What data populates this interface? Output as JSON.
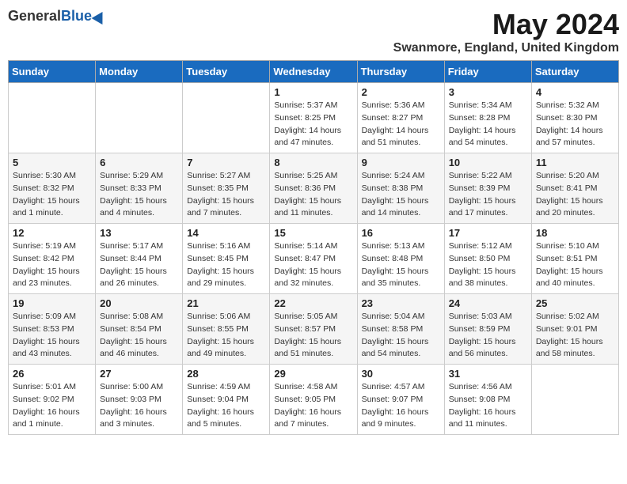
{
  "header": {
    "logo_general": "General",
    "logo_blue": "Blue",
    "month_title": "May 2024",
    "location": "Swanmore, England, United Kingdom"
  },
  "weekdays": [
    "Sunday",
    "Monday",
    "Tuesday",
    "Wednesday",
    "Thursday",
    "Friday",
    "Saturday"
  ],
  "weeks": [
    [
      {
        "day": "",
        "content": ""
      },
      {
        "day": "",
        "content": ""
      },
      {
        "day": "",
        "content": ""
      },
      {
        "day": "1",
        "content": "Sunrise: 5:37 AM\nSunset: 8:25 PM\nDaylight: 14 hours\nand 47 minutes."
      },
      {
        "day": "2",
        "content": "Sunrise: 5:36 AM\nSunset: 8:27 PM\nDaylight: 14 hours\nand 51 minutes."
      },
      {
        "day": "3",
        "content": "Sunrise: 5:34 AM\nSunset: 8:28 PM\nDaylight: 14 hours\nand 54 minutes."
      },
      {
        "day": "4",
        "content": "Sunrise: 5:32 AM\nSunset: 8:30 PM\nDaylight: 14 hours\nand 57 minutes."
      }
    ],
    [
      {
        "day": "5",
        "content": "Sunrise: 5:30 AM\nSunset: 8:32 PM\nDaylight: 15 hours\nand 1 minute."
      },
      {
        "day": "6",
        "content": "Sunrise: 5:29 AM\nSunset: 8:33 PM\nDaylight: 15 hours\nand 4 minutes."
      },
      {
        "day": "7",
        "content": "Sunrise: 5:27 AM\nSunset: 8:35 PM\nDaylight: 15 hours\nand 7 minutes."
      },
      {
        "day": "8",
        "content": "Sunrise: 5:25 AM\nSunset: 8:36 PM\nDaylight: 15 hours\nand 11 minutes."
      },
      {
        "day": "9",
        "content": "Sunrise: 5:24 AM\nSunset: 8:38 PM\nDaylight: 15 hours\nand 14 minutes."
      },
      {
        "day": "10",
        "content": "Sunrise: 5:22 AM\nSunset: 8:39 PM\nDaylight: 15 hours\nand 17 minutes."
      },
      {
        "day": "11",
        "content": "Sunrise: 5:20 AM\nSunset: 8:41 PM\nDaylight: 15 hours\nand 20 minutes."
      }
    ],
    [
      {
        "day": "12",
        "content": "Sunrise: 5:19 AM\nSunset: 8:42 PM\nDaylight: 15 hours\nand 23 minutes."
      },
      {
        "day": "13",
        "content": "Sunrise: 5:17 AM\nSunset: 8:44 PM\nDaylight: 15 hours\nand 26 minutes."
      },
      {
        "day": "14",
        "content": "Sunrise: 5:16 AM\nSunset: 8:45 PM\nDaylight: 15 hours\nand 29 minutes."
      },
      {
        "day": "15",
        "content": "Sunrise: 5:14 AM\nSunset: 8:47 PM\nDaylight: 15 hours\nand 32 minutes."
      },
      {
        "day": "16",
        "content": "Sunrise: 5:13 AM\nSunset: 8:48 PM\nDaylight: 15 hours\nand 35 minutes."
      },
      {
        "day": "17",
        "content": "Sunrise: 5:12 AM\nSunset: 8:50 PM\nDaylight: 15 hours\nand 38 minutes."
      },
      {
        "day": "18",
        "content": "Sunrise: 5:10 AM\nSunset: 8:51 PM\nDaylight: 15 hours\nand 40 minutes."
      }
    ],
    [
      {
        "day": "19",
        "content": "Sunrise: 5:09 AM\nSunset: 8:53 PM\nDaylight: 15 hours\nand 43 minutes."
      },
      {
        "day": "20",
        "content": "Sunrise: 5:08 AM\nSunset: 8:54 PM\nDaylight: 15 hours\nand 46 minutes."
      },
      {
        "day": "21",
        "content": "Sunrise: 5:06 AM\nSunset: 8:55 PM\nDaylight: 15 hours\nand 49 minutes."
      },
      {
        "day": "22",
        "content": "Sunrise: 5:05 AM\nSunset: 8:57 PM\nDaylight: 15 hours\nand 51 minutes."
      },
      {
        "day": "23",
        "content": "Sunrise: 5:04 AM\nSunset: 8:58 PM\nDaylight: 15 hours\nand 54 minutes."
      },
      {
        "day": "24",
        "content": "Sunrise: 5:03 AM\nSunset: 8:59 PM\nDaylight: 15 hours\nand 56 minutes."
      },
      {
        "day": "25",
        "content": "Sunrise: 5:02 AM\nSunset: 9:01 PM\nDaylight: 15 hours\nand 58 minutes."
      }
    ],
    [
      {
        "day": "26",
        "content": "Sunrise: 5:01 AM\nSunset: 9:02 PM\nDaylight: 16 hours\nand 1 minute."
      },
      {
        "day": "27",
        "content": "Sunrise: 5:00 AM\nSunset: 9:03 PM\nDaylight: 16 hours\nand 3 minutes."
      },
      {
        "day": "28",
        "content": "Sunrise: 4:59 AM\nSunset: 9:04 PM\nDaylight: 16 hours\nand 5 minutes."
      },
      {
        "day": "29",
        "content": "Sunrise: 4:58 AM\nSunset: 9:05 PM\nDaylight: 16 hours\nand 7 minutes."
      },
      {
        "day": "30",
        "content": "Sunrise: 4:57 AM\nSunset: 9:07 PM\nDaylight: 16 hours\nand 9 minutes."
      },
      {
        "day": "31",
        "content": "Sunrise: 4:56 AM\nSunset: 9:08 PM\nDaylight: 16 hours\nand 11 minutes."
      },
      {
        "day": "",
        "content": ""
      }
    ]
  ]
}
